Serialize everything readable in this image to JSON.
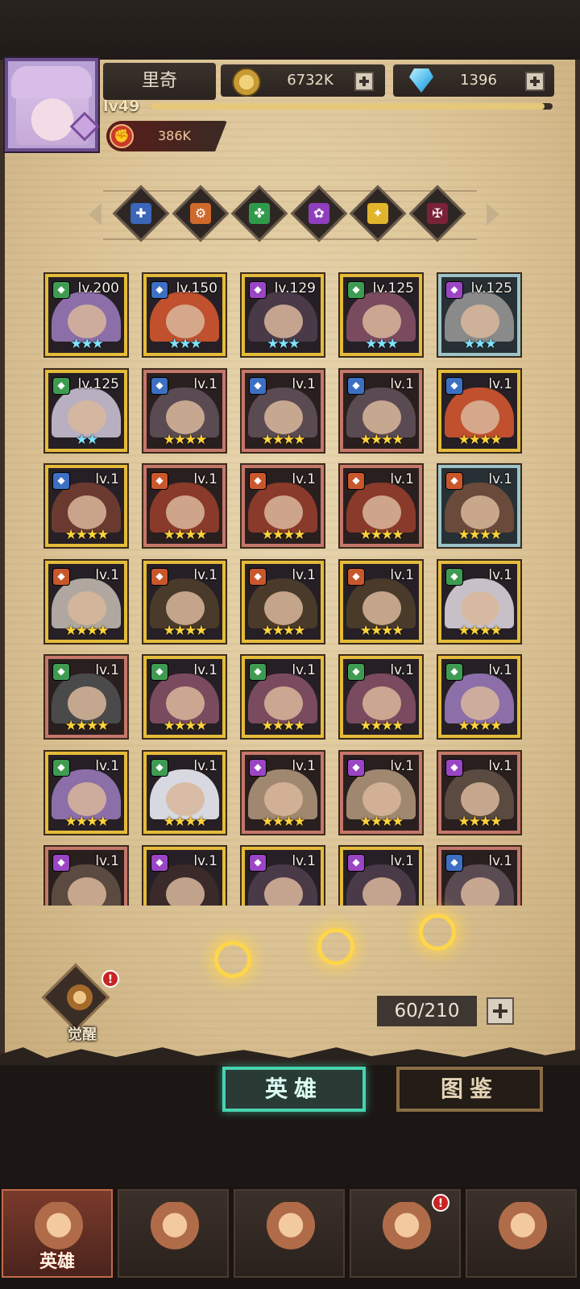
{
  "header": {
    "player_name": "里奇",
    "level": "lv49",
    "xp_progress": 0.98,
    "power": "386K",
    "gold": "6732K",
    "gems": "1396",
    "icons": {
      "gold": "gold-coin-icon",
      "gems": "diamond-icon",
      "power": "fist-icon"
    }
  },
  "factions": [
    {
      "name": "faction-blue",
      "glyph": "✚",
      "color": "#3c66b8"
    },
    {
      "name": "faction-orange",
      "glyph": "⚙",
      "color": "#cf6a2c"
    },
    {
      "name": "faction-green",
      "glyph": "✤",
      "color": "#2f9b4a"
    },
    {
      "name": "faction-purple",
      "glyph": "✿",
      "color": "#8e3fbd"
    },
    {
      "name": "faction-yellow",
      "glyph": "✦",
      "color": "#e0b52b"
    },
    {
      "name": "faction-darkred",
      "glyph": "✠",
      "color": "#7a2238"
    }
  ],
  "heroes": [
    {
      "lv": "lv.200",
      "stars": "★★★",
      "star_type": "blue",
      "frame": "gold",
      "cls": "#3f9b52",
      "art": "#8c6fa8"
    },
    {
      "lv": "lv.150",
      "stars": "★★★",
      "star_type": "blue",
      "frame": "gold",
      "cls": "#3d6fc2",
      "art": "#c0502e"
    },
    {
      "lv": "lv.129",
      "stars": "★★★",
      "star_type": "blue",
      "frame": "gold",
      "cls": "#9a45c4",
      "art": "#4a3a48"
    },
    {
      "lv": "lv.125",
      "stars": "★★★",
      "star_type": "blue",
      "frame": "gold",
      "cls": "#3f9b52",
      "art": "#7a4a5e"
    },
    {
      "lv": "lv.125",
      "stars": "★★★",
      "star_type": "blue",
      "frame": "silver",
      "cls": "#9a45c4",
      "art": "#8a8a8a"
    },
    {
      "lv": "lv.125",
      "stars": "★★",
      "star_type": "blue",
      "frame": "gold",
      "cls": "#3f9b52",
      "art": "#b8b0c0"
    },
    {
      "lv": "lv.1",
      "stars": "★★★★",
      "star_type": "gold",
      "frame": "bronze",
      "cls": "#3d6fc2",
      "art": "#5a4a52"
    },
    {
      "lv": "lv.1",
      "stars": "★★★★",
      "star_type": "gold",
      "frame": "bronze",
      "cls": "#3d6fc2",
      "art": "#5a4a52"
    },
    {
      "lv": "lv.1",
      "stars": "★★★★",
      "star_type": "gold",
      "frame": "bronze",
      "cls": "#3d6fc2",
      "art": "#5a4a52"
    },
    {
      "lv": "lv.1",
      "stars": "★★★★",
      "star_type": "gold",
      "frame": "gold",
      "cls": "#3d6fc2",
      "art": "#c0502e"
    },
    {
      "lv": "lv.1",
      "stars": "★★★★",
      "star_type": "gold",
      "frame": "gold",
      "cls": "#3d6fc2",
      "art": "#6a3a30"
    },
    {
      "lv": "lv.1",
      "stars": "★★★★",
      "star_type": "gold",
      "frame": "bronze",
      "cls": "#c9572c",
      "art": "#8a3a2a"
    },
    {
      "lv": "lv.1",
      "stars": "★★★★",
      "star_type": "gold",
      "frame": "bronze",
      "cls": "#c9572c",
      "art": "#8a3a2a"
    },
    {
      "lv": "lv.1",
      "stars": "★★★★",
      "star_type": "gold",
      "frame": "bronze",
      "cls": "#c9572c",
      "art": "#8a3a2a"
    },
    {
      "lv": "lv.1",
      "stars": "★★★★",
      "star_type": "gold",
      "frame": "silver",
      "cls": "#c9572c",
      "art": "#6a4a3a"
    },
    {
      "lv": "lv.1",
      "stars": "★★★★",
      "star_type": "gold",
      "frame": "gold",
      "cls": "#c9572c",
      "art": "#b0a8a0"
    },
    {
      "lv": "lv.1",
      "stars": "★★★★",
      "star_type": "gold",
      "frame": "gold",
      "cls": "#c9572c",
      "art": "#4a3a2a"
    },
    {
      "lv": "lv.1",
      "stars": "★★★★",
      "star_type": "gold",
      "frame": "gold",
      "cls": "#c9572c",
      "art": "#4a3a2a"
    },
    {
      "lv": "lv.1",
      "stars": "★★★★",
      "star_type": "gold",
      "frame": "gold",
      "cls": "#c9572c",
      "art": "#4a3a2a"
    },
    {
      "lv": "lv.1",
      "stars": "★★★★",
      "star_type": "gold",
      "frame": "gold",
      "cls": "#3f9b52",
      "art": "#c8c0c8"
    },
    {
      "lv": "lv.1",
      "stars": "★★★★",
      "star_type": "gold",
      "frame": "bronze",
      "cls": "#3f9b52",
      "art": "#4a4a4a"
    },
    {
      "lv": "lv.1",
      "stars": "★★★★",
      "star_type": "gold",
      "frame": "gold",
      "cls": "#3f9b52",
      "art": "#7a4a5e"
    },
    {
      "lv": "lv.1",
      "stars": "★★★★",
      "star_type": "gold",
      "frame": "gold",
      "cls": "#3f9b52",
      "art": "#7a4a5e"
    },
    {
      "lv": "lv.1",
      "stars": "★★★★",
      "star_type": "gold",
      "frame": "gold",
      "cls": "#3f9b52",
      "art": "#7a4a5e"
    },
    {
      "lv": "lv.1",
      "stars": "★★★★",
      "star_type": "gold",
      "frame": "gold",
      "cls": "#3f9b52",
      "art": "#8c6fa8"
    },
    {
      "lv": "lv.1",
      "stars": "★★★★",
      "star_type": "gold",
      "frame": "gold",
      "cls": "#3f9b52",
      "art": "#8c6fa8"
    },
    {
      "lv": "lv.1",
      "stars": "★★★★",
      "star_type": "gold",
      "frame": "gold",
      "cls": "#3f9b52",
      "art": "#d8d8e0"
    },
    {
      "lv": "lv.1",
      "stars": "★★★★",
      "star_type": "gold",
      "frame": "bronze",
      "cls": "#9a45c4",
      "art": "#a08870"
    },
    {
      "lv": "lv.1",
      "stars": "★★★★",
      "star_type": "gold",
      "frame": "bronze",
      "cls": "#9a45c4",
      "art": "#a08870"
    },
    {
      "lv": "lv.1",
      "stars": "★★★★",
      "star_type": "gold",
      "frame": "bronze",
      "cls": "#9a45c4",
      "art": "#5a4a40"
    },
    {
      "lv": "lv.1",
      "stars": "",
      "star_type": "gold",
      "frame": "bronze",
      "cls": "#9a45c4",
      "art": "#5a4a40"
    },
    {
      "lv": "lv.1",
      "stars": "",
      "star_type": "gold",
      "frame": "gold",
      "cls": "#9a45c4",
      "art": "#3a2a2a"
    },
    {
      "lv": "lv.1",
      "stars": "",
      "star_type": "gold",
      "frame": "gold",
      "cls": "#9a45c4",
      "art": "#4a3a48"
    },
    {
      "lv": "lv.1",
      "stars": "",
      "star_type": "gold",
      "frame": "gold",
      "cls": "#9a45c4",
      "art": "#4a3a48"
    },
    {
      "lv": "lv.1",
      "stars": "",
      "star_type": "gold",
      "frame": "bronze",
      "cls": "#3d6fc2",
      "art": "#5a4a52"
    }
  ],
  "awaken": {
    "label": "觉醒",
    "alert": "!"
  },
  "hero_count": "60/210",
  "view_tabs": {
    "heroes": "英雄",
    "codex": "图鉴"
  },
  "bottom_nav": [
    {
      "label": "英雄",
      "icon": "helmet-icon",
      "active": true
    },
    {
      "label": "",
      "icon": "flag-icon",
      "active": false
    },
    {
      "label": "",
      "icon": "crossed-swords-icon",
      "active": false
    },
    {
      "label": "",
      "icon": "castle-icon",
      "active": false,
      "alert": "!"
    },
    {
      "label": "",
      "icon": "guild-emblem-icon",
      "active": false
    }
  ]
}
